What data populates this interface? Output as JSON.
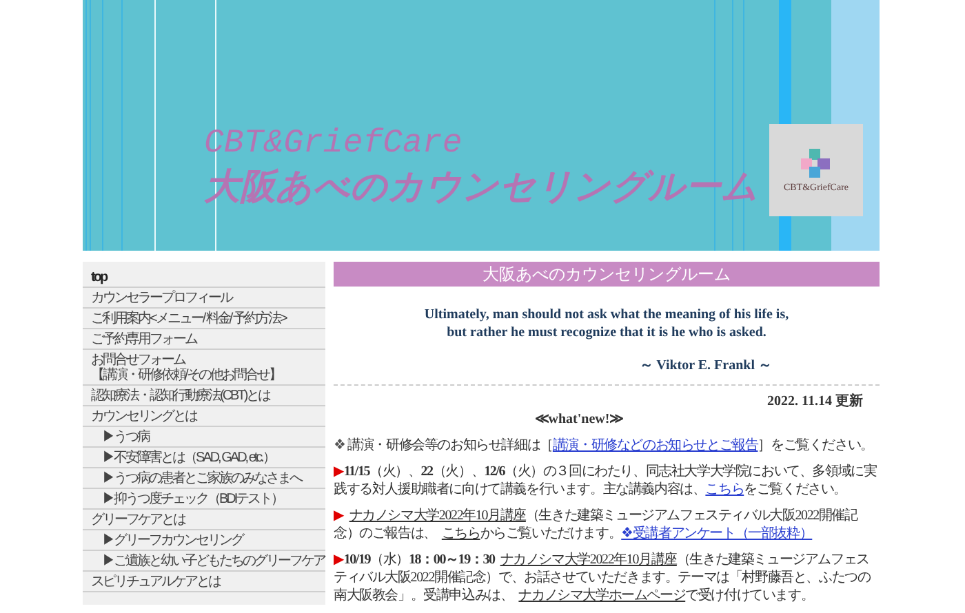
{
  "header": {
    "subtitle": "CBT&GriefCare",
    "title": "大阪あべのカウンセリングルーム",
    "logo_text": "CBT&GriefCare"
  },
  "sidebar": {
    "items": [
      {
        "label": "top",
        "selected": true
      },
      {
        "label": "カウンセラープロフィール",
        "selected": false
      },
      {
        "label": "ご利用案内<メニュー/ 料金/ 予約方法>",
        "selected": false
      },
      {
        "label": "ご予約専用フォーム",
        "selected": false
      },
      {
        "label": "お問合せフォーム",
        "sublabel": "【講演・研修依頼/その他お問合せ】",
        "selected": false
      },
      {
        "label": "認知療法・認知行動療法(CBT)とは",
        "selected": false
      },
      {
        "label": "カウンセリングとは",
        "selected": false,
        "children": [
          {
            "label": "▶うつ病",
            "selected": false
          },
          {
            "label": "▶不安障害とは（SAD, GAD, etc.）",
            "selected": false
          },
          {
            "label": "▶うつ病の患者とご家族のみなさまへ",
            "selected": false
          },
          {
            "label": "▶抑うつ度チェック（BDIテスト）",
            "selected": false
          }
        ]
      },
      {
        "label": "グリーフケアとは",
        "selected": false,
        "children": [
          {
            "label": "▶グリーフカウンセリング",
            "selected": false
          },
          {
            "label": "▶ご遺族と幼い子どもたちのグリーフケア",
            "selected": false
          }
        ]
      },
      {
        "label": "スピリチュアルケアとは",
        "selected": false
      }
    ]
  },
  "main": {
    "heading": "大阪あべのカウンセリングルーム",
    "quote": [
      "Ultimately, man should not ask what the meaning of his life is,",
      "but rather he must recognize that it is he who is asked."
    ],
    "quote_author": "～ Viktor E. Frankl ～",
    "updated": "2022. 11.14 更新",
    "news_heading": "≪what'new!≫",
    "paragraphs": [
      [
        {
          "kind": "bullet",
          "text": "❖"
        },
        {
          "kind": "text",
          "text": " 講演・研修会等のお知らせ詳細は［"
        },
        {
          "kind": "link",
          "text": "講演・研修などのお知らせとご報告"
        },
        {
          "kind": "text",
          "text": "］をご覧ください。"
        }
      ],
      [
        {
          "kind": "mark",
          "text": "▶"
        },
        {
          "kind": "bold",
          "text": "11/15"
        },
        {
          "kind": "text",
          "text": "（火）、"
        },
        {
          "kind": "bold",
          "text": "22"
        },
        {
          "kind": "text",
          "text": "（火）、"
        },
        {
          "kind": "bold",
          "text": "12/6"
        },
        {
          "kind": "text",
          "text": "（火）の３回にわたり、同志社大学大学院において、多領域に実践する対人援助職者に向けて講義を行います。主な講義内容は、"
        },
        {
          "kind": "link",
          "text": "こちら"
        },
        {
          "kind": "text",
          "text": "をご覧ください。"
        }
      ],
      [
        {
          "kind": "mark",
          "text": "▶"
        },
        {
          "kind": "darklink",
          "text": "ナカノシマ大学2022年10月講座"
        },
        {
          "kind": "text",
          "text": "（生きた建築ミュージアムフェスティバル大阪2022開催記念）のご報告は、"
        },
        {
          "kind": "darklink",
          "text": "こちら"
        },
        {
          "kind": "text",
          "text": "からご覧いただけます。"
        },
        {
          "kind": "link",
          "text": "❖受講者アンケート（一部抜粋）"
        }
      ],
      [
        {
          "kind": "mark",
          "text": "▶"
        },
        {
          "kind": "bold",
          "text": "10/19"
        },
        {
          "kind": "text",
          "text": "（水）"
        },
        {
          "kind": "bold",
          "text": "18：00～19：30"
        },
        {
          "kind": "darklink",
          "text": "ナカノシマ大学2022年10月講座"
        },
        {
          "kind": "text",
          "text": "（生きた建築ミュージアムフェスティバル大阪2022開催記念）で、お話させていただきます。テーマは「村野藤吾と、ふたつの南大阪教会」。受講申込みは、"
        },
        {
          "kind": "darklink",
          "text": "ナカノシマ大学ホームページ"
        },
        {
          "kind": "text",
          "text": "で受け付けています。"
        }
      ]
    ]
  }
}
